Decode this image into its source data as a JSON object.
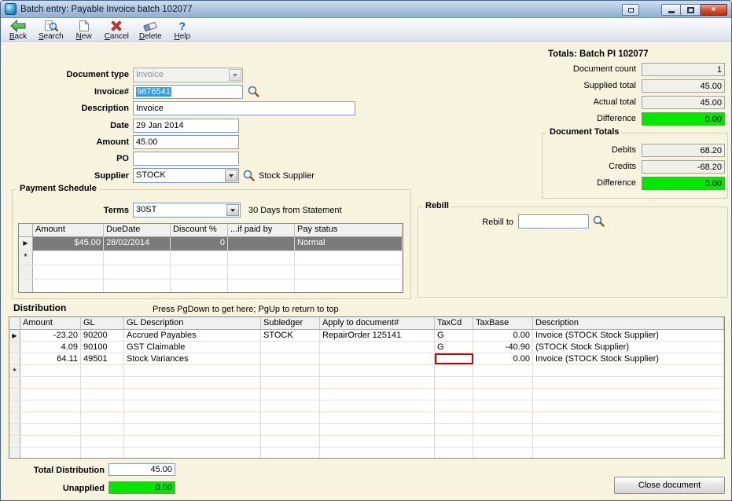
{
  "window": {
    "title": "Batch entry: Payable Invoice batch 102077"
  },
  "toolbar": {
    "buttons": [
      {
        "label": "Back",
        "icon": "back-arrow"
      },
      {
        "label": "Search",
        "icon": "search-magnifier"
      },
      {
        "label": "New",
        "icon": "new-document"
      },
      {
        "label": "Cancel",
        "icon": "red-cross"
      },
      {
        "label": "Delete",
        "icon": "eraser"
      },
      {
        "label": "Help",
        "icon": "question-mark"
      }
    ]
  },
  "form": {
    "document_type": {
      "label": "Document type",
      "value": "Invoice"
    },
    "invoice_number": {
      "label": "Invoice#",
      "value": "9876541"
    },
    "description": {
      "label": "Description",
      "value": "Invoice"
    },
    "date": {
      "label": "Date",
      "value": "29 Jan 2014"
    },
    "amount": {
      "label": "Amount",
      "value": "45.00"
    },
    "po": {
      "label": "PO",
      "value": ""
    },
    "supplier": {
      "label": "Supplier",
      "value": "STOCK",
      "display_name": "Stock Supplier"
    }
  },
  "payment_schedule": {
    "title": "Payment Schedule",
    "terms": {
      "label": "Terms",
      "value": "30ST",
      "description": "30 Days from Statement"
    },
    "grid": {
      "columns": [
        "Amount",
        "DueDate",
        "Discount %",
        "...if paid by",
        "Pay status"
      ],
      "row": {
        "amount": "$45.00",
        "due_date": "28/02/2014",
        "discount": "0",
        "if_paid_by": "",
        "pay_status": "Normal"
      },
      "current_row_marker": "▶",
      "new_row_marker": "*"
    }
  },
  "batch_totals": {
    "title": "Totals: Batch PI 102077",
    "document_count": {
      "label": "Document count",
      "value": "1"
    },
    "supplied_total": {
      "label": "Supplied total",
      "value": "45.00"
    },
    "actual_total": {
      "label": "Actual total",
      "value": "45.00"
    },
    "difference": {
      "label": "Difference",
      "value": "0.00"
    }
  },
  "document_totals": {
    "title": "Document Totals",
    "debits": {
      "label": "Debits",
      "value": "68.20"
    },
    "credits": {
      "label": "Credits",
      "value": "-68.20"
    },
    "difference": {
      "label": "Difference",
      "value": "0.00"
    }
  },
  "rebill": {
    "title": "Rebill",
    "rebill_to_label": "Rebill to",
    "rebill_to_value": ""
  },
  "distribution": {
    "title": "Distribution",
    "hint": "Press PgDown to get here; PgUp to return to top",
    "columns": [
      "Amount",
      "GL",
      "GL Description",
      "Subledger",
      "Apply to document#",
      "TaxCd",
      "TaxBase",
      "Description"
    ],
    "rows": [
      {
        "amount": "-23.20",
        "gl": "90200",
        "gl_desc": "Accrued Payables",
        "subledger": "STOCK",
        "apply_to": "RepairOrder 125141",
        "taxcd": "G",
        "taxbase": "0.00",
        "description": "Invoice (STOCK Stock Supplier)"
      },
      {
        "amount": "4.09",
        "gl": "90100",
        "gl_desc": "GST Claimable",
        "subledger": "",
        "apply_to": "",
        "taxcd": "G",
        "taxbase": "-40.90",
        "description": "(STOCK Stock Supplier)"
      },
      {
        "amount": "64.11",
        "gl": "49501",
        "gl_desc": "Stock Variances",
        "subledger": "",
        "apply_to": "",
        "taxcd": "",
        "taxbase": "0.00",
        "description": "Invoice (STOCK Stock Supplier)"
      }
    ],
    "current_row_marker": "▶",
    "new_row_marker": "*",
    "total": {
      "label": "Total Distribution",
      "value": "45.00"
    },
    "unapplied": {
      "label": "Unapplied",
      "value": "0.00"
    }
  },
  "footer": {
    "close_button": "Close document"
  },
  "colors": {
    "highlight_green": "#00e800",
    "selected_row_gray": "#7b7b7b",
    "error_border_red": "#cc0000",
    "text_selection_blue": "#3399e0"
  }
}
